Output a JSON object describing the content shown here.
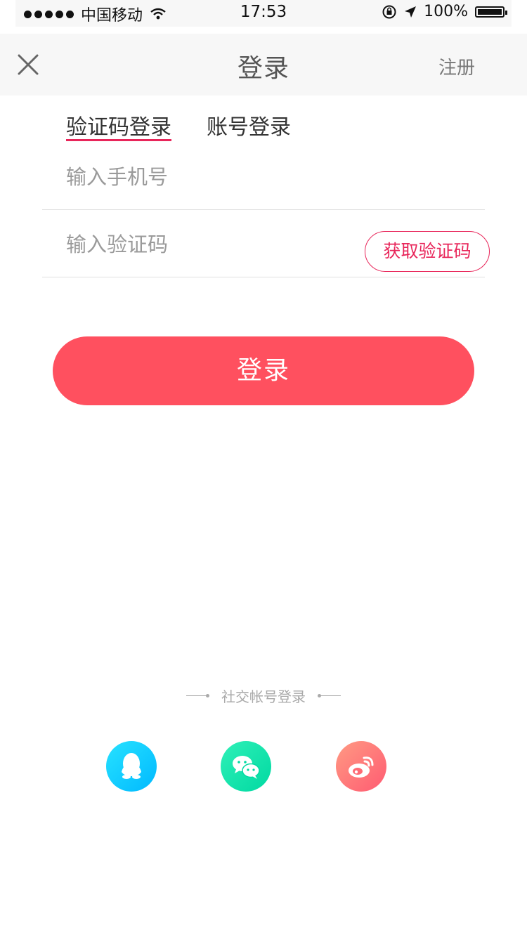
{
  "status_bar": {
    "carrier": "中国移动",
    "time": "17:53",
    "battery": "100%"
  },
  "nav": {
    "title": "登录",
    "register": "注册"
  },
  "tabs": [
    {
      "label": "验证码登录",
      "active": true
    },
    {
      "label": "账号登录",
      "active": false
    }
  ],
  "form": {
    "phone_placeholder": "输入手机号",
    "code_placeholder": "输入验证码",
    "get_code": "获取验证码",
    "login": "登录"
  },
  "social": {
    "title": "社交帐号登录",
    "items": [
      {
        "icon": "qq-icon",
        "color": "#1fd2ff"
      },
      {
        "icon": "wechat-icon",
        "color": "#1ee6b0"
      },
      {
        "icon": "weibo-icon",
        "color": "#ff7a7a"
      }
    ]
  },
  "colors": {
    "accent": "#e8265a",
    "login_button": "#ff505f"
  }
}
